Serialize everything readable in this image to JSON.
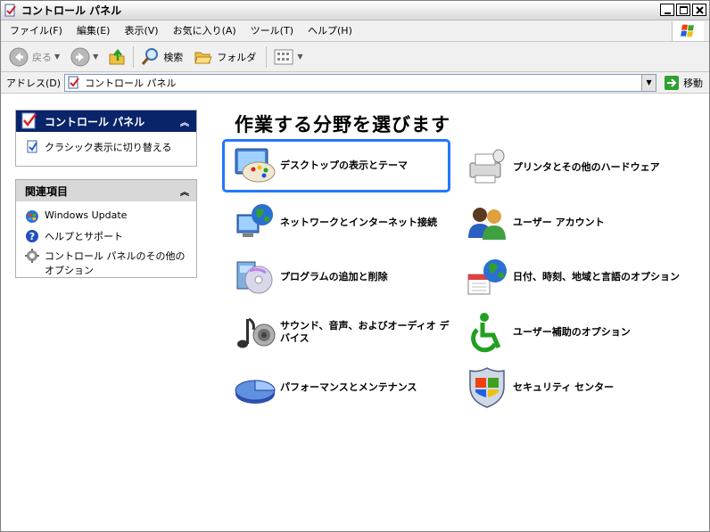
{
  "window": {
    "title": "コントロール パネル"
  },
  "menu": [
    "ファイル(F)",
    "編集(E)",
    "表示(V)",
    "お気に入り(A)",
    "ツール(T)",
    "ヘルプ(H)"
  ],
  "toolbar": {
    "back": "戻る",
    "search": "検索",
    "folders": "フォルダ"
  },
  "address": {
    "label": "アドレス(D)",
    "value": "コントロール パネル",
    "go": "移動"
  },
  "panel_control": {
    "title": "コントロール パネル",
    "switch_link": "クラシック表示に切り替える"
  },
  "panel_related": {
    "title": "関連項目",
    "items": [
      "Windows Update",
      "ヘルプとサポート",
      "コントロール パネルのその他のオプション"
    ]
  },
  "heading": "作業する分野を選びます",
  "categories": [
    "デスクトップの表示とテーマ",
    "プリンタとその他のハードウェア",
    "ネットワークとインターネット接続",
    "ユーザー アカウント",
    "プログラムの追加と削除",
    "日付、時刻、地域と言語のオプション",
    "サウンド、音声、およびオーディオ デバイス",
    "ユーザー補助のオプション",
    "パフォーマンスとメンテナンス",
    "セキュリティ センター"
  ],
  "colors": {
    "selection_border": "#2277ff",
    "panel_header": "#0a246a"
  }
}
